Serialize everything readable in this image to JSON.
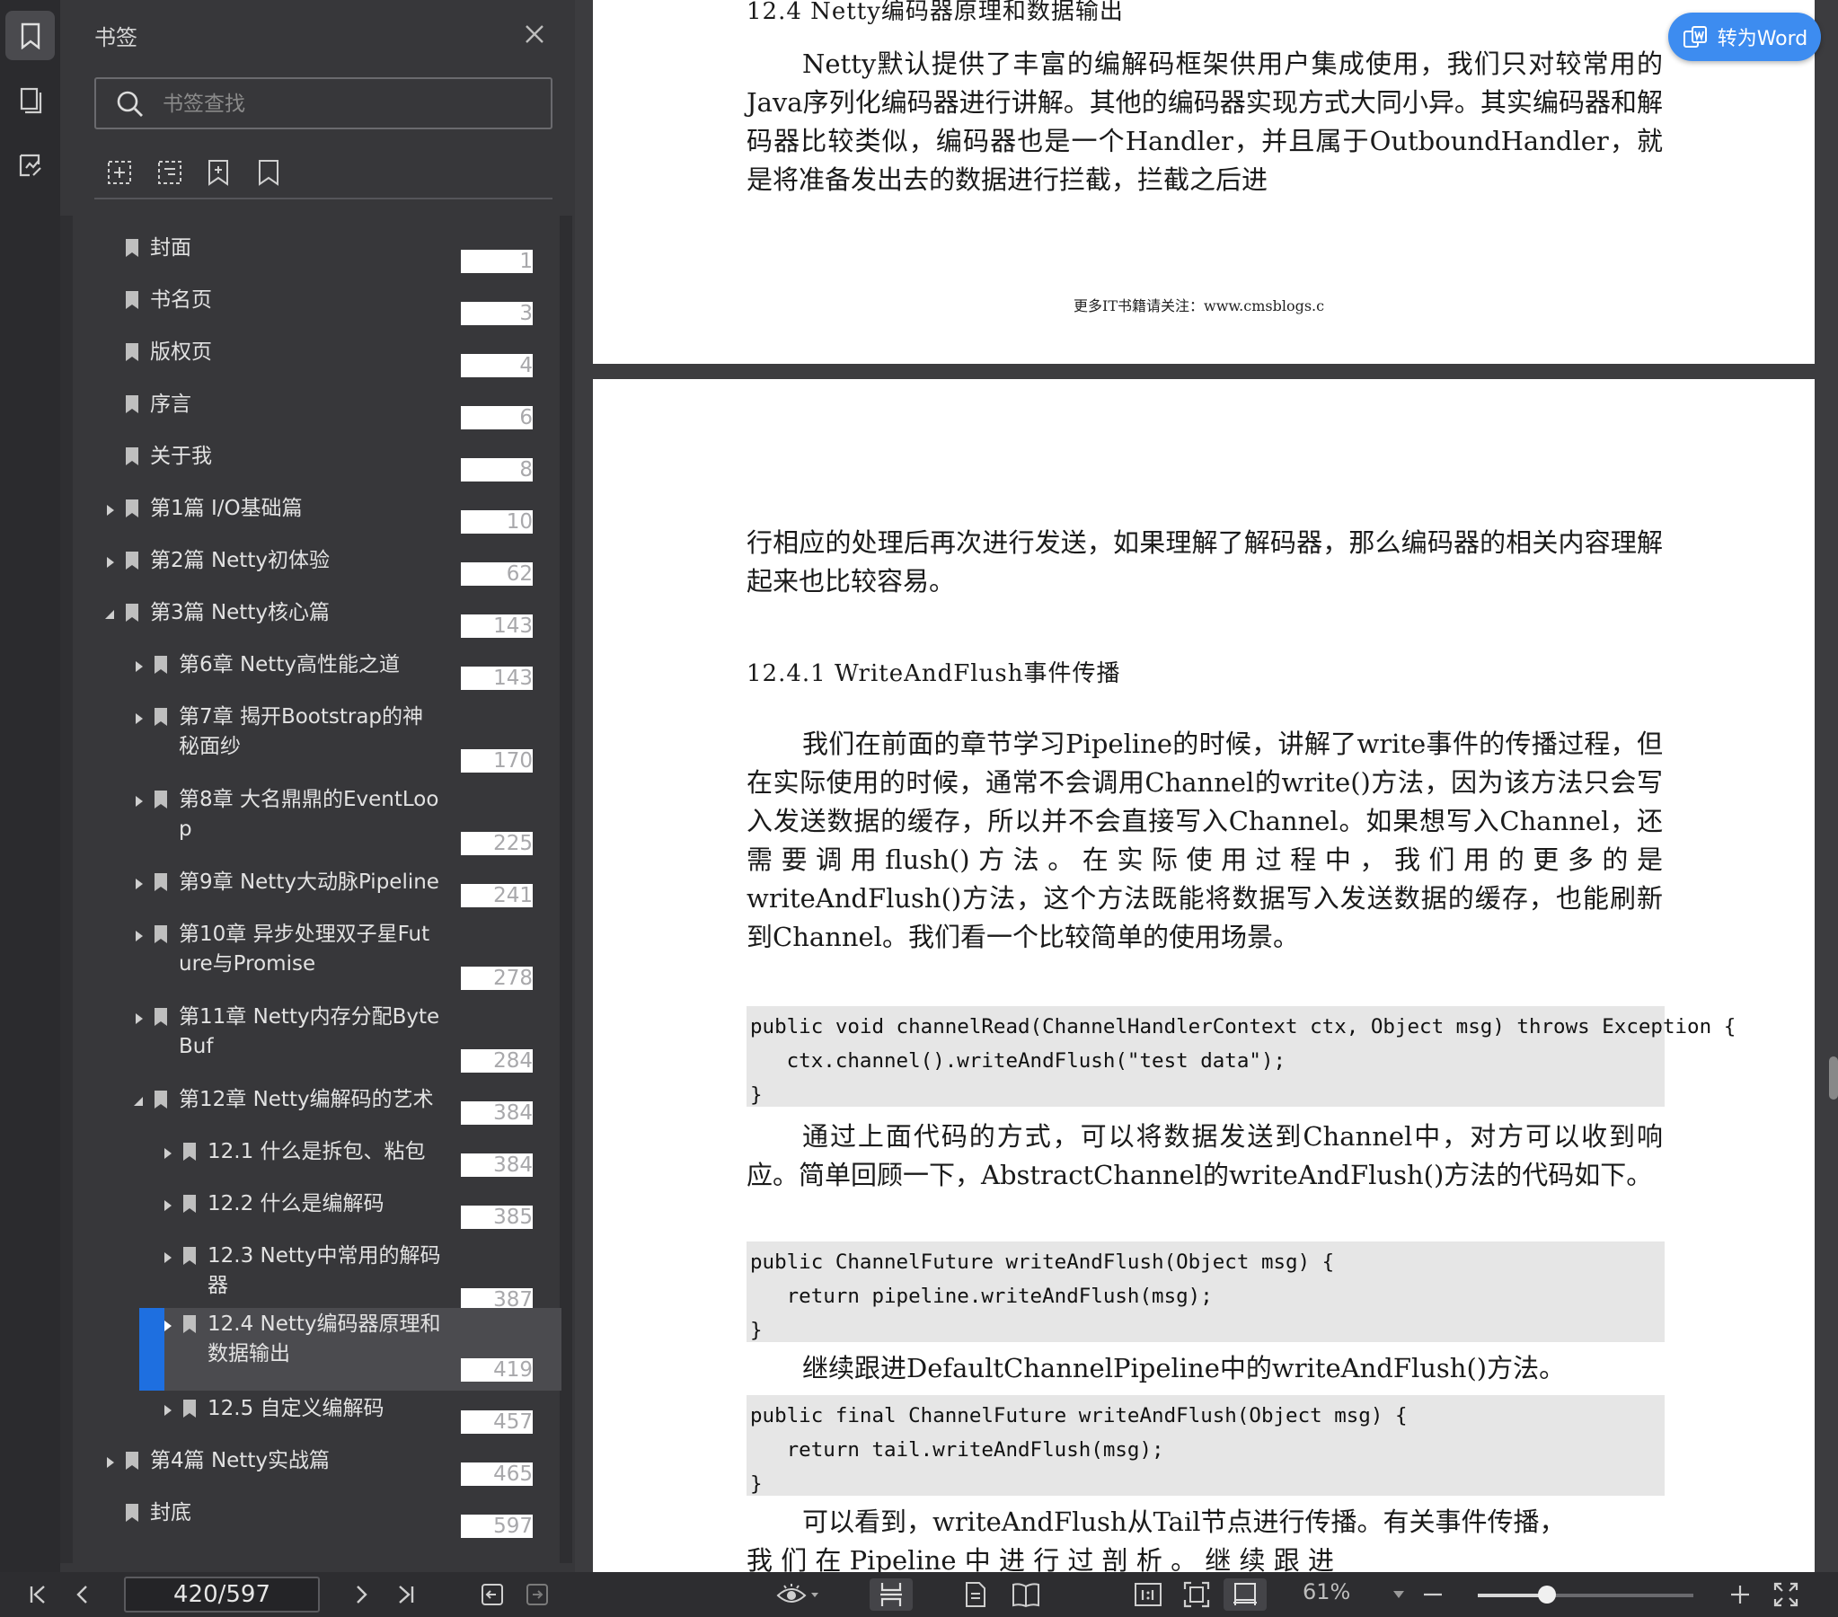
{
  "sidebar": {
    "title": "书签",
    "search_placeholder": "书签查找",
    "bookmarks": [
      {
        "label": "封面",
        "page": "1"
      },
      {
        "label": "书名页",
        "page": "3"
      },
      {
        "label": "版权页",
        "page": "4"
      },
      {
        "label": "序言",
        "page": "6"
      },
      {
        "label": "关于我",
        "page": "8"
      },
      {
        "label": "第1篇 I/O基础篇",
        "page": "10"
      },
      {
        "label": "第2篇 Netty初体验",
        "page": "62"
      },
      {
        "label": "第3篇 Netty核心篇",
        "page": "143"
      },
      {
        "label": "第6章 Netty高性能之道",
        "page": "143"
      },
      {
        "label": "第7章 揭开Bootstrap的神\n秘面纱",
        "page": "170"
      },
      {
        "label": "第8章 大名鼎鼎的EventLoo\np",
        "page": "225"
      },
      {
        "label": "第9章 Netty大动脉Pipeline",
        "page": "241"
      },
      {
        "label": "第10章 异步处理双子星Fut\nure与Promise",
        "page": "278"
      },
      {
        "label": "第11章 Netty内存分配Byte\nBuf",
        "page": "284"
      },
      {
        "label": "第12章 Netty编解码的艺术",
        "page": "384"
      },
      {
        "label": "12.1 什么是拆包、粘包",
        "page": "384"
      },
      {
        "label": "12.2 什么是编解码",
        "page": "385"
      },
      {
        "label": "12.3 Netty中常用的解码\n器",
        "page": "387"
      },
      {
        "label": "12.4 Netty编码器原理和\n数据输出",
        "page": "419"
      },
      {
        "label": "12.5 自定义编解码",
        "page": "457"
      },
      {
        "label": "第4篇 Netty实战篇",
        "page": "465"
      },
      {
        "label": "封底",
        "page": "597"
      }
    ]
  },
  "document": {
    "page1": {
      "heading": "12.4 Netty编码器原理和数据输出",
      "paragraph": "Netty默认提供了丰富的编解码框架供用户集成使用，我们只对较常用的Java序列化编码器进行讲解。其他的编码器实现方式大同小异。其实编码器和解码器比较类似，编码器也是一个Handler，并且属于OutboundHandler，就是将准备发出去的数据进行拦截，拦截之后进",
      "footer": "更多IT书籍请关注：www.cmsblogs.c"
    },
    "page2": {
      "paragraph1": "行相应的处理后再次进行发送，如果理解了解码器，那么编码器的相关内容理解起来也比较容易。",
      "heading": "12.4.1 WriteAndFlush事件传播",
      "paragraph2": "我们在前面的章节学习Pipeline的时候，讲解了write事件的传播过程，但在实际使用的时候，通常不会调用Channel的write()方法，因为该方法只会写入发送数据的缓存，所以并不会直接写入Channel。如果想写入Channel，还需要调用flush()方法。在实际使用过程中，我们用的更多的是writeAndFlush()方法，这个方法既能将数据写入发送数据的缓存，也能刷新到Channel。我们看一个比较简单的使用场景。",
      "code1": "public void channelRead(ChannelHandlerContext ctx, Object msg) throws Exception {\n   ctx.channel().writeAndFlush(\"test data\");\n}",
      "paragraph3": "通过上面代码的方式，可以将数据发送到Channel中，对方可以收到响应。简单回顾一下，AbstractChannel的writeAndFlush()方法的代码如下。",
      "code2": "public ChannelFuture writeAndFlush(Object msg) {\n   return pipeline.writeAndFlush(msg);\n}",
      "paragraph4": "继续跟进DefaultChannelPipeline中的writeAndFlush()方法。",
      "code3": "public final ChannelFuture writeAndFlush(Object msg) {\n   return tail.writeAndFlush(msg);\n}",
      "paragraph5": "可以看到，writeAndFlush从Tail节点进行传播。有关事件传播，",
      "paragraph6": "我 们 在 Pipeline 中 进 行 过 剖 析 。 继 续 跟 进"
    }
  },
  "convert_button": "转为Word",
  "bottombar": {
    "page_indicator": "420/597",
    "zoom": "61%",
    "zoom_fraction": 0.32
  },
  "colors": {
    "accent": "#1e6fe0",
    "convert_button": "#3d8cf0",
    "sidebar_bg": "#37373a",
    "rail_bg": "#2b2b2e"
  }
}
